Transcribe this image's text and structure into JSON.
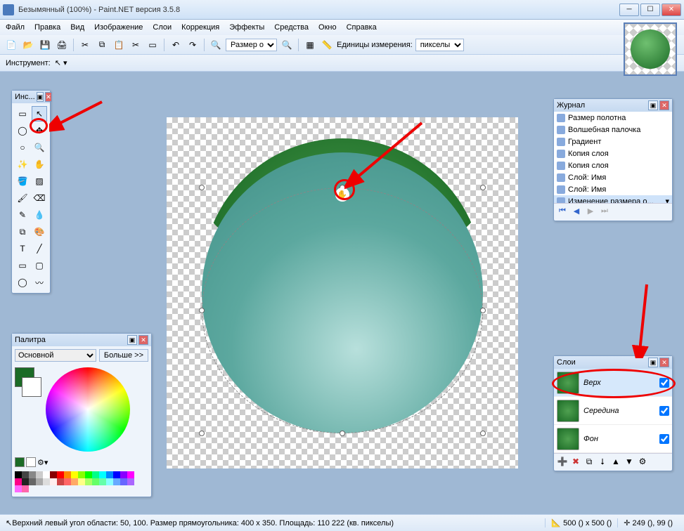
{
  "window": {
    "title": "Безымянный (100%) - Paint.NET версия 3.5.8"
  },
  "menu": [
    "Файл",
    "Правка",
    "Вид",
    "Изображение",
    "Слои",
    "Коррекция",
    "Эффекты",
    "Средства",
    "Окно",
    "Справка"
  ],
  "toolbar": {
    "size_label": "Размер о",
    "units_label": "Единицы измерения:",
    "units_value": "пикселы"
  },
  "toolinfo": {
    "label": "Инструмент:"
  },
  "tools_panel": {
    "title": "Инс..."
  },
  "history_panel": {
    "title": "Журнал",
    "items": [
      "Размер полотна",
      "Волшебная палочка",
      "Градиент",
      "Копия слоя",
      "Копия слоя",
      "Слой: Имя",
      "Слой: Имя",
      "Изменение размера о..."
    ]
  },
  "layers_panel": {
    "title": "Слои",
    "layers": [
      {
        "name": "Верх",
        "selected": true
      },
      {
        "name": "Середина",
        "selected": false
      },
      {
        "name": "Фон",
        "selected": false
      }
    ]
  },
  "palette_panel": {
    "title": "Палитра",
    "mode": "Основной",
    "more": "Больше >>"
  },
  "status": {
    "text": "Верхний левый угол области: 50, 100. Размер прямоугольника: 400 x 350. Площадь: 110 222 (кв. пикселы)",
    "dims": "500 () x 500 ()",
    "cursor": "249 (), 99 ()"
  }
}
